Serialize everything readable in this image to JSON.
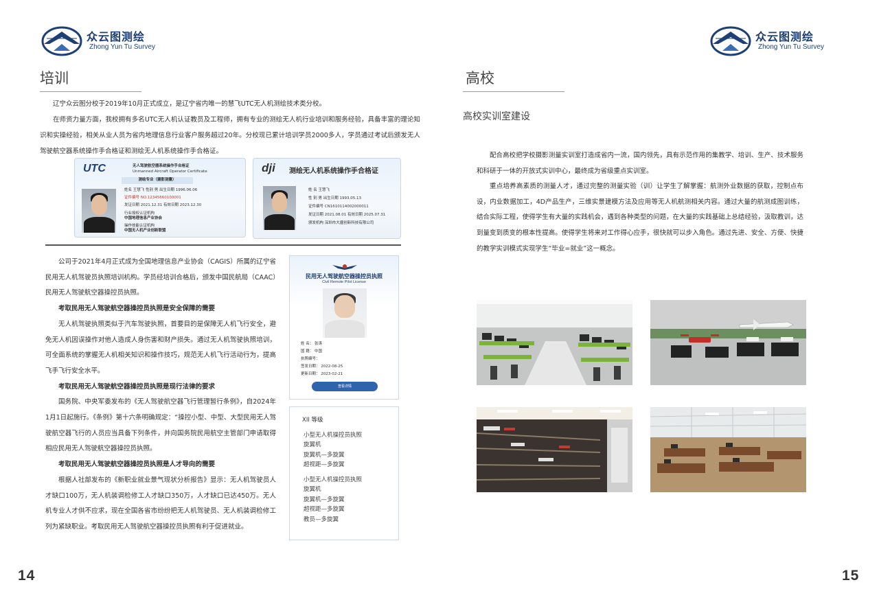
{
  "logo": {
    "brand_cn": "众云图测绘",
    "brand_en": "Zhong Yun Tu Survey"
  },
  "left": {
    "title": "培训",
    "intro": [
      "辽宁众云图分校于2019年10月正式成立，是辽宁省内唯一的慧飞UTC无人机测绘技术类分校。",
      "在师资力量方面，我校拥有多名UTC无人机认证教员及工程师，拥有专业的测绘无人机行业培训和服务经验，具备丰富的理论知识和实操经验，相关从业人员为省内地理信息行业客户服务超过20年。分校现已累计培训学员2000多人，学员通过考试后颁发无人驾驶航空器系统操作手合格证和测绘无人机系统操作手合格证。"
    ],
    "cert_utc": {
      "logo": "UTC",
      "title_cn": "无人驾驶航空器系统操作手合格证",
      "title_en": "Unmanned Aircraft Operator Certificate",
      "major": "测绘专业（摄影测量）",
      "lines": [
        "姓名    王慧飞  性别 男  出生日期 1996.06.06",
        "证件编号  NO.12345660100001",
        "发证日期  2021.12.31   有效日期  2023.12.30",
        "行业授权认证机构",
        "中国地理信息产业协会",
        "操作技能认证机构",
        "中国无人机产业创新联盟"
      ]
    },
    "cert_dji": {
      "logo": "dji",
      "title": "测绘无人机系统操作手合格证",
      "lines": [
        "姓    名  王慧飞",
        "性    别  男        出生日期  1993.05.13",
        "证件编号  CN1610114002000011",
        "发证日期  2021.08.01   有效日期  2025.07.31",
        "颁发机构  深圳市大疆创新科技有限公司"
      ]
    },
    "caac_paragraphs": [
      {
        "type": "text",
        "text": "公司于2021年4月正式成为全国地理信息产业协会（CAGIS）所属的辽宁省民用无人机驾驶员执照培训机构。学员经培训合格后，颁发中国民航局（CAAC）民用无人驾驶航空器操控员执照。"
      },
      {
        "type": "heading",
        "text": "考取民用无人驾驶航空器操控员执照是安全保障的需要"
      },
      {
        "type": "text",
        "text": "无人机驾驶执照类似于汽车驾驶执照，首要目的是保障无人机飞行安全，避免无人机因误操作对他人造成人身伤害和财产损失。通过无人机驾驶执照培训，可全面系统的掌握无人机相关知识和操作技巧，规范无人机飞行活动行为，提高飞手飞行安全水平。"
      },
      {
        "type": "heading",
        "text": "考取民用无人驾驶航空器操控员执照是现行法律的要求"
      },
      {
        "type": "text",
        "text": "国务院、中央军委发布的《无人驾驶航空器飞行管理暂行条例》，自2024年1月1日起施行。《条例》第十六条明确规定：“操控小型、中型、大型民用无人驾驶航空器飞行的人员应当具备下列条件，并向国务院民用航空主管部门申请取得相应民用无人驾驶航空器操控员执照。"
      },
      {
        "type": "heading",
        "text": "考取民用无人驾驶航空器操控员执照是人才导向的需要"
      },
      {
        "type": "text",
        "text": "根据人社部发布的《新职业就业景气现状分析报告》显示：无人机驾驶员人才缺口100万，无人机装调检修工人才缺口350万，人才缺口已达450万。无人机专业人才供不应求，现在全国各省市纷纷把无人机驾驶员、无人机装调检修工列为紧缺职业。考取民用无人驾驶航空器操控员执照有利于促进就业。"
      }
    ],
    "license": {
      "title_cn": "民用无人驾驶航空器操控员执照",
      "title_en": "Civil Remote Pilot License",
      "fields": [
        "姓    名：  张涛",
        "国    籍：  中国",
        "执照编号：",
        "签发日期：  2022-08-25",
        "更新日期：  2023-02-21"
      ],
      "button": "查看详情"
    },
    "levels": {
      "title": "XII  等级",
      "items": [
        "小型无人机操控员执照",
        "旋翼机",
        "旋翼机—多旋翼",
        "超视距—多旋翼",
        "",
        "小型无人机操控员执照",
        "旋翼机",
        "旋翼机—多旋翼",
        "超视距—多旋翼",
        "教员—多旋翼"
      ]
    },
    "page_number": "14"
  },
  "right": {
    "title": "高校",
    "subtitle": "高校实训室建设",
    "paragraphs": [
      "配合高校把学校摄影测量实训室打造成省内一流，国内领先，具有示范作用的集教学、培训、生产、技术服务和科研于一体的开放式实训中心，最终成为省级重点实训室。",
      "重点培养高素质的测量人才，通过完整的测量实验（训）让学生了解掌握：航测外业数据的获取，控制点布设，内业数据加工，4D产品生产，三维实景建模方法及应用等无人机航测相关内容。通过大量的航测成图训练，结合实际工程，使得学生有大量的实践机会，遇到各种类型的问题，在大量的实践基础上总结经验，汲取教训，达到量变到质变的根本性提高。使得学生将来对工作得心应手，很快就可以步入角色。通过先进、安全、方便、快捷的教学实训模式实现学生“毕业=就业”这一概念。"
    ],
    "page_number": "15"
  },
  "colors": {
    "brand_blue": "#1e3f73",
    "button_blue": "#2f63ad",
    "text": "#333333"
  }
}
